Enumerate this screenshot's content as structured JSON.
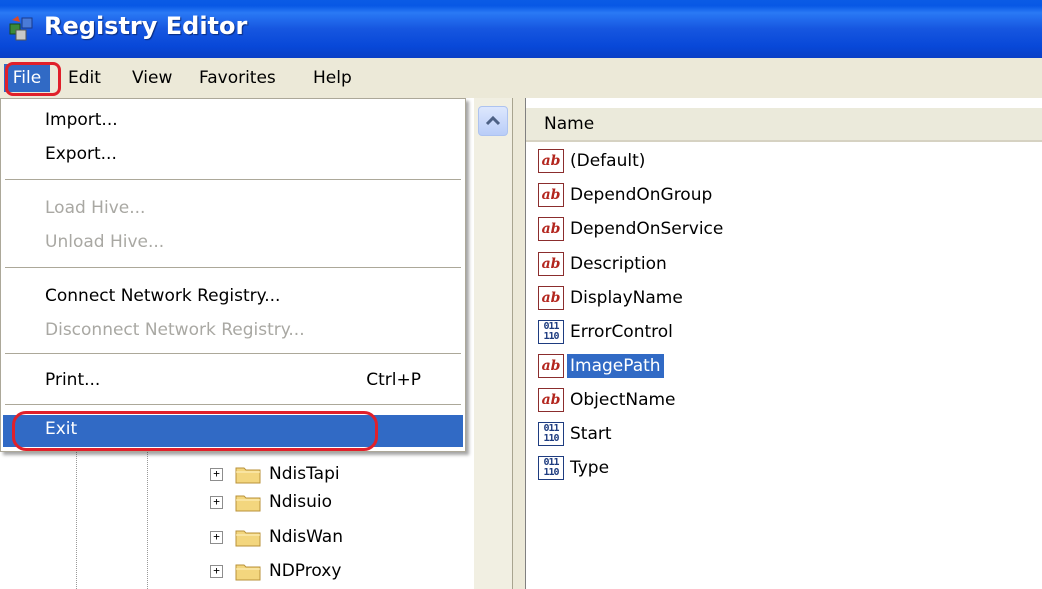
{
  "window": {
    "title": "Registry Editor",
    "icon": "registry-editor-icon"
  },
  "menubar": {
    "items": [
      "File",
      "Edit",
      "View",
      "Favorites",
      "Help"
    ]
  },
  "file_menu": {
    "import": "Import...",
    "export": "Export...",
    "load_hive": "Load Hive...",
    "unload_hive": "Unload Hive...",
    "connect": "Connect Network Registry...",
    "disconnect": "Disconnect Network Registry...",
    "print": "Print...",
    "print_shortcut": "Ctrl+P",
    "exit": "Exit"
  },
  "tree": {
    "items": [
      "NdisTapi",
      "Ndisuio",
      "NdisWan",
      "NDProxy"
    ]
  },
  "list": {
    "column_name": "Name",
    "rows": [
      {
        "name": "(Default)",
        "type": "string"
      },
      {
        "name": "DependOnGroup",
        "type": "string"
      },
      {
        "name": "DependOnService",
        "type": "string"
      },
      {
        "name": "Description",
        "type": "string"
      },
      {
        "name": "DisplayName",
        "type": "string"
      },
      {
        "name": "ErrorControl",
        "type": "binary"
      },
      {
        "name": "ImagePath",
        "type": "string",
        "selected": true
      },
      {
        "name": "ObjectName",
        "type": "string"
      },
      {
        "name": "Start",
        "type": "binary"
      },
      {
        "name": "Type",
        "type": "binary"
      }
    ]
  },
  "colors": {
    "selection": "#316ac5",
    "highlight_ring": "#e0202a",
    "titlebar": "#0a5be5"
  }
}
